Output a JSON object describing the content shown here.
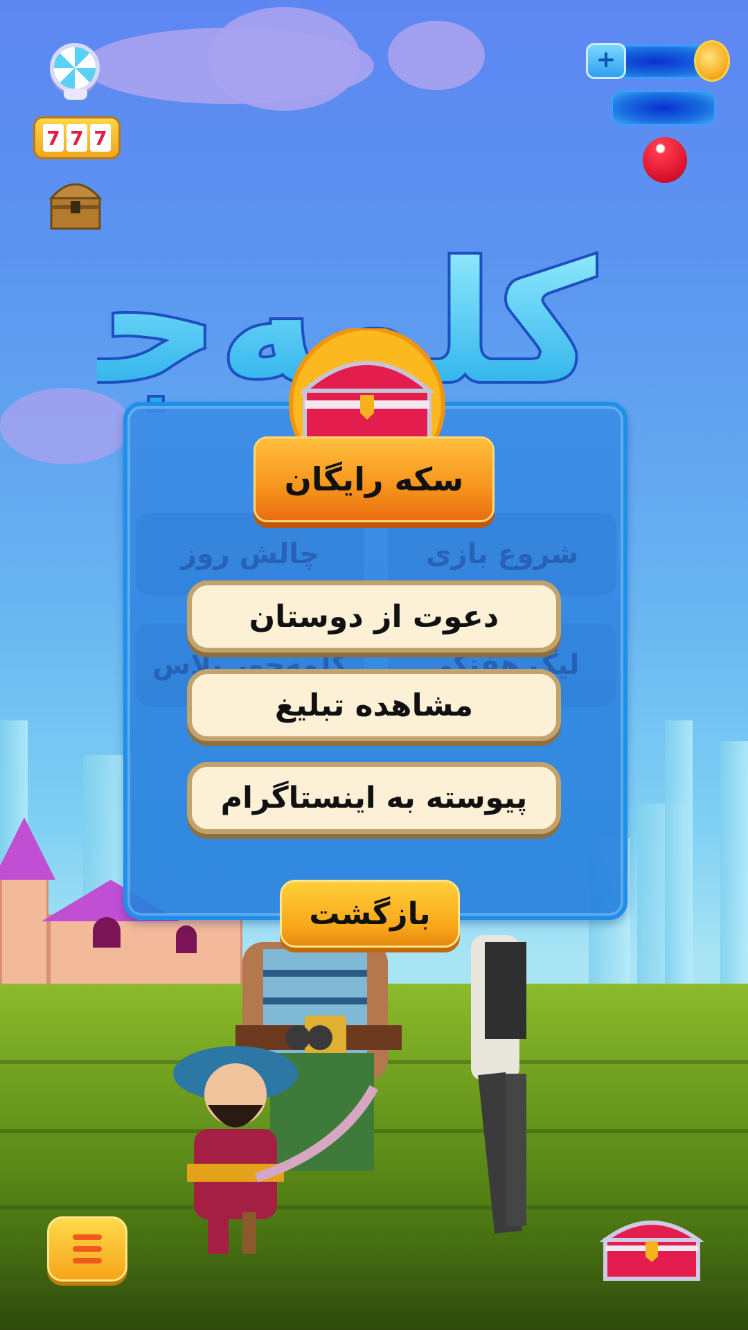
{
  "hud": {
    "plus_icon": "plus-icon",
    "plus_label": "+",
    "coin_icon": "coin-icon"
  },
  "left_tools": {
    "slot_digits": [
      "7",
      "7",
      "7"
    ]
  },
  "logo_text": "کلمه‌جور",
  "dialog": {
    "free_coin_label": "سکه رایگان",
    "background_buttons": [
      {
        "label": "چالش روز"
      },
      {
        "label": "شروع بازی"
      },
      {
        "label": "کلمه‌جور پلاس"
      },
      {
        "label": "لیگ هفتگی"
      }
    ],
    "options": [
      {
        "label": "دعوت از دوستان"
      },
      {
        "label": "مشاهده تبلیغ"
      },
      {
        "label": "پیوسته به اینستاگرام"
      }
    ],
    "back_label": "بازگشت"
  },
  "colors": {
    "accent_orange": "#f7941d",
    "panel_blue": "#2a86e0",
    "option_cream": "#fcf1d6",
    "option_border": "#c3a36d"
  }
}
